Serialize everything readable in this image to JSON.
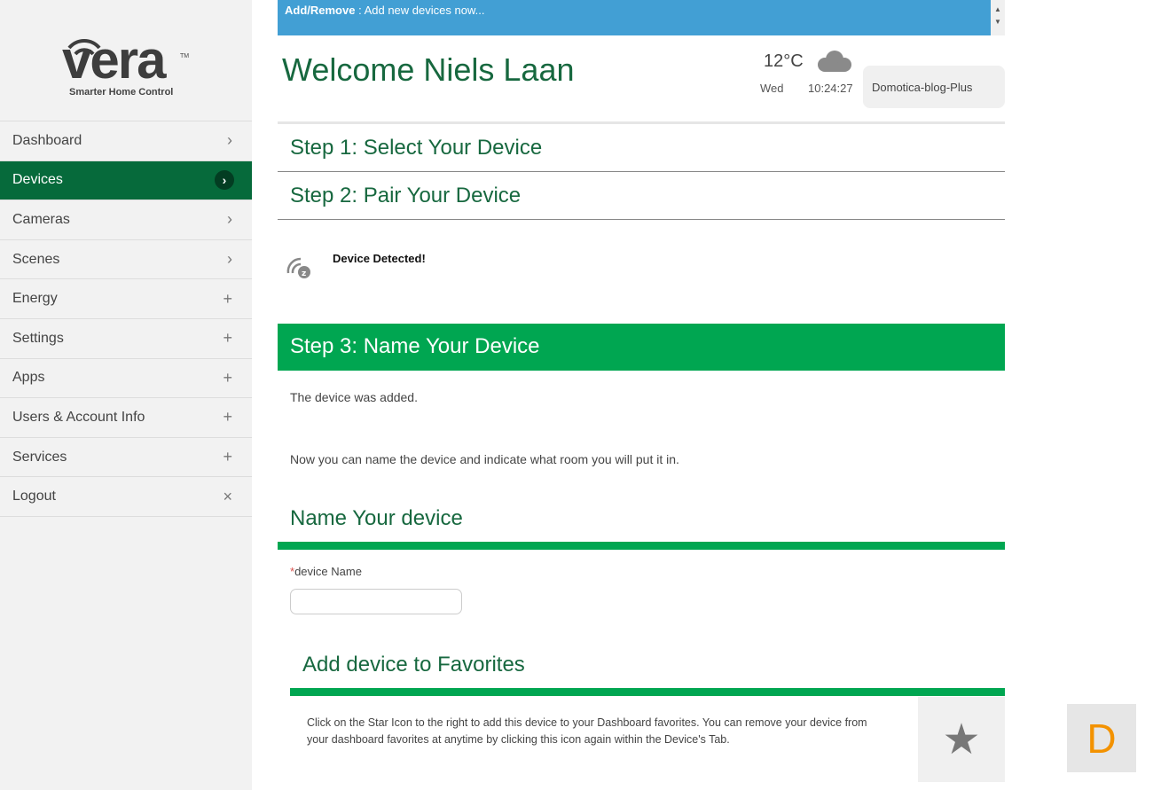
{
  "logo": {
    "word": "vera",
    "tm": "TM",
    "tagline": "Smarter Home Control"
  },
  "nav": [
    {
      "label": "Dashboard",
      "icon": "›"
    },
    {
      "label": "Devices",
      "icon": "›"
    },
    {
      "label": "Cameras",
      "icon": "›"
    },
    {
      "label": "Scenes",
      "icon": "›"
    },
    {
      "label": "Energy",
      "icon": "+"
    },
    {
      "label": "Settings",
      "icon": "+"
    },
    {
      "label": "Apps",
      "icon": "+"
    },
    {
      "label": "Users & Account Info",
      "icon": "+"
    },
    {
      "label": "Services",
      "icon": "+"
    },
    {
      "label": "Logout",
      "icon": "×"
    }
  ],
  "banner": {
    "bold": "Add/Remove",
    "text": " : Add new devices now..."
  },
  "header": {
    "welcome": "Welcome Niels Laan",
    "temp": "12°C",
    "day": "Wed",
    "time": "10:24:27",
    "account": "Domotica-blog-Plus"
  },
  "steps": {
    "s1": "Step 1: Select Your Device",
    "s2": "Step 2: Pair Your Device",
    "detected": "Device Detected!",
    "s3": "Step 3: Name Your Device"
  },
  "content": {
    "added": "The device was added.",
    "instr": "Now you can name the device and indicate what room you will put it in.",
    "name_heading": "Name Your device",
    "req": "*",
    "field_label": "device Name",
    "field_value": "",
    "fav_heading": "Add device to Favorites",
    "fav_text": "Click on the Star Icon to the right to add this device to your Dashboard favorites. You can remove your device from your dashboard favorites at anytime by clicking this icon again within the Device's Tab.",
    "d_label": "D"
  }
}
